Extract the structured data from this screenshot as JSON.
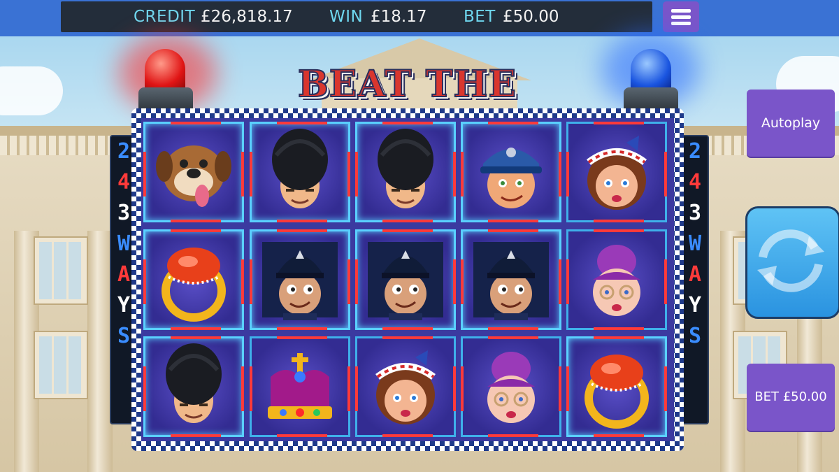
{
  "status": {
    "credit_label": "CREDIT",
    "credit_value": "£26,818.17",
    "win_label": "WIN",
    "win_value": "£18.17",
    "bet_label": "BET",
    "bet_value": "£50.00"
  },
  "menu": {
    "icon": "hamburger-menu-icon"
  },
  "game": {
    "title": "BEAT THE BOBBIES",
    "ways_text": [
      "2",
      "4",
      "3",
      "W",
      "A",
      "Y",
      "S"
    ]
  },
  "reels": [
    [
      "bulldog",
      "ring",
      "guard"
    ],
    [
      "guard",
      "bobby",
      "crown"
    ],
    [
      "guard",
      "bobby",
      "lady"
    ],
    [
      "policeman",
      "bobby",
      "granny"
    ],
    [
      "lady",
      "granny",
      "ring"
    ]
  ],
  "winning_cells": [
    [
      1,
      1
    ],
    [
      2,
      1
    ],
    [
      3,
      1
    ],
    [
      0,
      0
    ],
    [
      1,
      0
    ],
    [
      2,
      0
    ],
    [
      3,
      0
    ],
    [
      4,
      2
    ],
    [
      0,
      1
    ],
    [
      0,
      2
    ]
  ],
  "controls": {
    "autoplay_label": "Autoplay",
    "spin_icon": "spin-refresh-icon",
    "bet_button_label": "BET £50.00"
  },
  "colors": {
    "accent_purple": "#7a55c9",
    "topbar_blue": "#3a72d4",
    "stat_label_cyan": "#6fd7ef",
    "spin_blue": "#2a93e0"
  }
}
